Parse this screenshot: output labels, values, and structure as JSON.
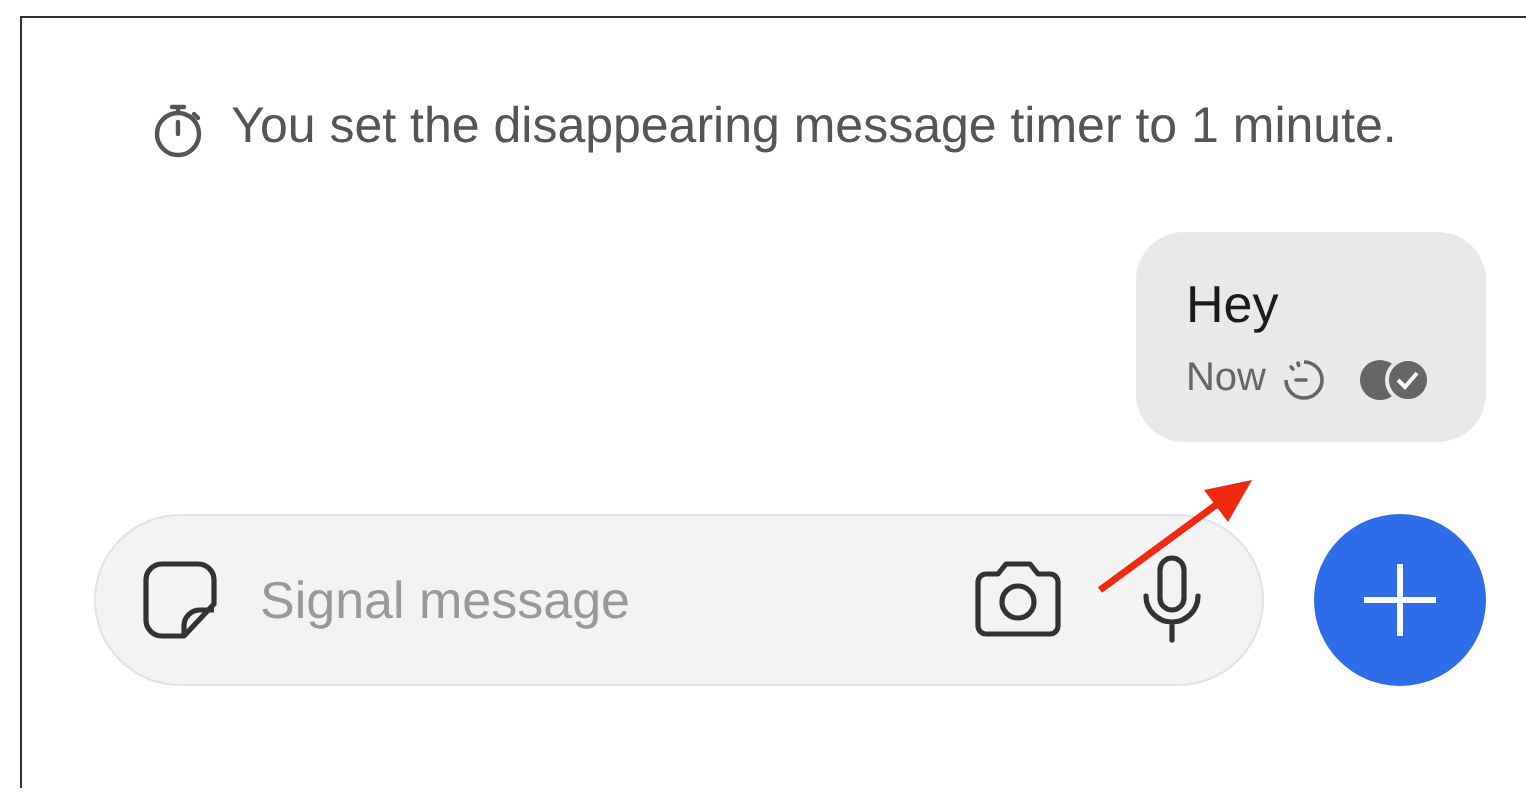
{
  "notice": {
    "text": "You set the disappearing message timer to 1 minute."
  },
  "messages": [
    {
      "text": "Hey",
      "time": "Now"
    }
  ],
  "composer": {
    "placeholder": "Signal message"
  }
}
